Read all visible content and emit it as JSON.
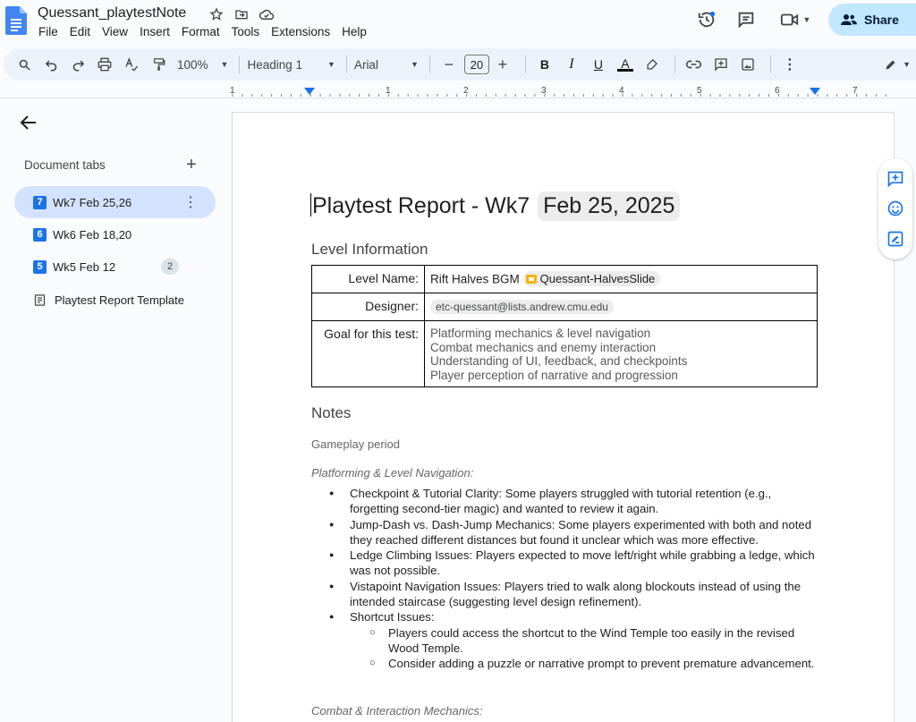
{
  "app": {
    "doc_title": "Quessant_playtestNote",
    "menu": [
      "File",
      "Edit",
      "View",
      "Insert",
      "Format",
      "Tools",
      "Extensions",
      "Help"
    ],
    "share_label": "Share"
  },
  "toolbar": {
    "zoom": "100%",
    "style": "Heading 1",
    "font": "Arial",
    "font_size": "20",
    "bold": "B",
    "italic": "I",
    "underline": "U",
    "text_color": "A"
  },
  "ruler": {
    "numbers": [
      "1",
      "1",
      "2",
      "3",
      "4",
      "5",
      "6",
      "7"
    ]
  },
  "sidebar": {
    "header": "Document tabs",
    "add": "+",
    "tabs": [
      {
        "num": "7",
        "label": "Wk7 Feb 25,26",
        "active": true
      },
      {
        "num": "6",
        "label": "Wk6 Feb 18,20"
      },
      {
        "num": "5",
        "label": "Wk5 Feb 12",
        "badge": "2"
      },
      {
        "num": "",
        "label": "Playtest Report Template"
      }
    ]
  },
  "document": {
    "title": "Playtest Report - Wk7",
    "title_date": "Feb 25, 2025",
    "level_heading": "Level Information",
    "table": {
      "level_name_label": "Level Name:",
      "level_name_value": "Rift Halves BGM",
      "level_name_file": "Quessant-HalvesSlide",
      "designer_label": "Designer:",
      "designer_value": "etc-quessant@lists.andrew.cmu.edu",
      "goal_label": "Goal for this test:",
      "goals": [
        "Platforming mechanics & level navigation",
        "Combat mechanics and enemy interaction",
        "Understanding of UI, feedback, and checkpoints",
        "Player perception of narrative and progression"
      ]
    },
    "notes_heading": "Notes",
    "gameplay_period": "Gameplay period",
    "platforming_heading": "Platforming & Level Navigation:",
    "bullets": [
      "Checkpoint & Tutorial Clarity: Some players struggled with tutorial retention (e.g., forgetting second-tier magic) and wanted to review it again.",
      "Jump-Dash vs. Dash-Jump Mechanics: Some players experimented with both and noted they reached different distances but found it unclear which was more effective.",
      "Ledge Climbing Issues: Players expected to move left/right while grabbing a ledge, which was not possible.",
      "Vistapoint Navigation Issues: Players tried to walk along blockouts instead of using the intended staircase (suggesting level design refinement).",
      "Shortcut Issues:"
    ],
    "sub_bullets": [
      "Players could access the shortcut to the Wind Temple too easily in the revised Wood Temple.",
      "Consider adding a puzzle or narrative prompt to prevent premature advancement."
    ],
    "combat_heading": "Combat & Interaction Mechanics:"
  },
  "colors": {
    "accent": "#1a73e8",
    "share_bg": "#c2e7ff",
    "active_tab_bg": "#d3e3fd",
    "toolbar_bg": "#edf2fa"
  }
}
